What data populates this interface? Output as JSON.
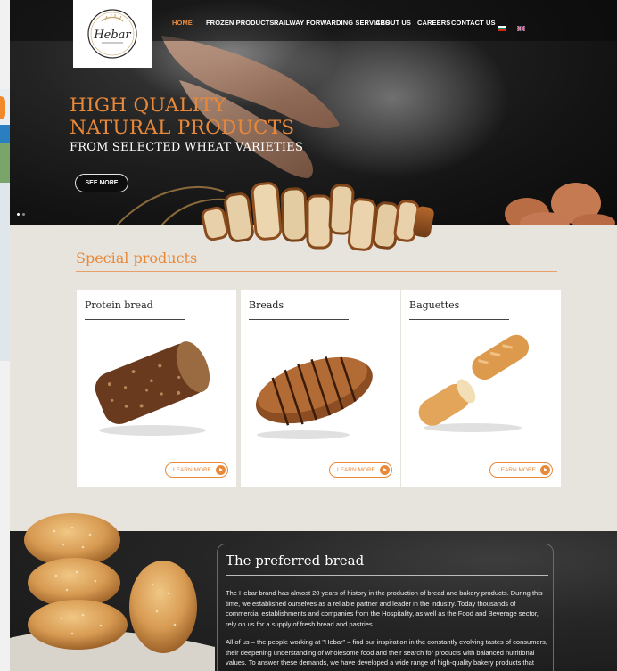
{
  "nav": {
    "items": [
      {
        "label": "HOME",
        "active": true
      },
      {
        "label": "FROZEN PRODUCTS",
        "active": false
      },
      {
        "label": "RAILWAY FORWARDING SERVICES",
        "active": false
      },
      {
        "label": "ABOUT US",
        "active": false
      },
      {
        "label": "CAREERS",
        "active": false
      },
      {
        "label": "CONTACT US",
        "active": false
      }
    ],
    "languages": [
      "bulgarian-flag-icon",
      "uk-flag-icon"
    ]
  },
  "logo": {
    "brand": "Hebar"
  },
  "hero": {
    "title_line1": "HIGH QUALITY",
    "title_line2": "NATURAL PRODUCTS",
    "subtitle": "FROM SELECTED WHEAT VARIETIES",
    "cta": "SEE MORE"
  },
  "special": {
    "title": "Special products",
    "cards": [
      {
        "title": "Protein bread",
        "cta": "LEARN MORE",
        "image": "dark-grain-loaf"
      },
      {
        "title": "Breads",
        "cta": "LEARN MORE",
        "image": "sliced-loaf"
      },
      {
        "title": "Baguettes",
        "cta": "LEARN MORE",
        "image": "baguette"
      }
    ]
  },
  "preferred": {
    "title": "The preferred bread",
    "p1": "The Hebar brand has almost 20 years of history in the production of bread and bakery products. During this time, we established ourselves as a reliable partner and leader in the industry. Today thousands of commercial establishments and companies from the Hospitality, as well as the Food and Beverage sector, rely on us for a supply of fresh bread and pastries.",
    "p2": "All of us – the people working at \"Hebar\" – find our inspiration in the constantly evolving tastes of consumers, their deepening understanding of wholesome food and their search for products with balanced nutritional values. To answer these demands, we have developed a wide range of high-quality bakery products that meet"
  },
  "colors": {
    "accent": "#e8893a",
    "dark": "#151515",
    "card": "#ffffff",
    "background": "#e7e3dd"
  }
}
